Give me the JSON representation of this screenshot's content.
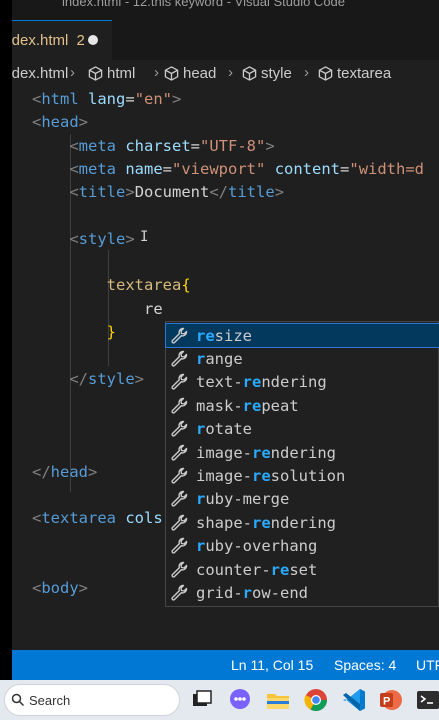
{
  "window": {
    "title": "index.html - 12.this keyword - Visual Studio Code"
  },
  "tab": {
    "label": "index.html",
    "problems": "2"
  },
  "breadcrumb": {
    "file": "index.html",
    "items": [
      "html",
      "head",
      "style",
      "textarea"
    ]
  },
  "code_lines": [
    [
      {
        "c": "t-brk",
        "t": "<"
      },
      {
        "c": "t-tag",
        "t": "html"
      },
      {
        "c": "t-txt",
        "t": " "
      },
      {
        "c": "t-attr",
        "t": "lang"
      },
      {
        "c": "t-txt",
        "t": "="
      },
      {
        "c": "t-str",
        "t": "\"en\""
      },
      {
        "c": "t-brk",
        "t": ">"
      }
    ],
    [
      {
        "c": "t-brk",
        "t": "<"
      },
      {
        "c": "t-tag",
        "t": "head"
      },
      {
        "c": "t-brk",
        "t": ">"
      }
    ],
    [
      {
        "c": "t-txt",
        "t": "    "
      },
      {
        "c": "t-brk",
        "t": "<"
      },
      {
        "c": "t-tag",
        "t": "meta"
      },
      {
        "c": "t-txt",
        "t": " "
      },
      {
        "c": "t-attr",
        "t": "charset"
      },
      {
        "c": "t-txt",
        "t": "="
      },
      {
        "c": "t-str",
        "t": "\"UTF-8\""
      },
      {
        "c": "t-brk",
        "t": ">"
      }
    ],
    [
      {
        "c": "t-txt",
        "t": "    "
      },
      {
        "c": "t-brk",
        "t": "<"
      },
      {
        "c": "t-tag",
        "t": "meta"
      },
      {
        "c": "t-txt",
        "t": " "
      },
      {
        "c": "t-attr",
        "t": "name"
      },
      {
        "c": "t-txt",
        "t": "="
      },
      {
        "c": "t-str",
        "t": "\"viewport\""
      },
      {
        "c": "t-txt",
        "t": " "
      },
      {
        "c": "t-attr",
        "t": "content"
      },
      {
        "c": "t-txt",
        "t": "="
      },
      {
        "c": "t-str",
        "t": "\"width=d"
      }
    ],
    [
      {
        "c": "t-txt",
        "t": "    "
      },
      {
        "c": "t-brk",
        "t": "<"
      },
      {
        "c": "t-tag",
        "t": "title"
      },
      {
        "c": "t-brk",
        "t": ">"
      },
      {
        "c": "t-txt",
        "t": "Document"
      },
      {
        "c": "t-brk",
        "t": "</"
      },
      {
        "c": "t-tag",
        "t": "title"
      },
      {
        "c": "t-brk",
        "t": ">"
      }
    ],
    [],
    [
      {
        "c": "t-txt",
        "t": "    "
      },
      {
        "c": "t-brk",
        "t": "<"
      },
      {
        "c": "t-tag",
        "t": "style"
      },
      {
        "c": "t-brk",
        "t": ">"
      }
    ],
    [],
    [
      {
        "c": "t-txt",
        "t": "        "
      },
      {
        "c": "t-sel",
        "t": "textarea"
      },
      {
        "c": "t-brace",
        "t": "{"
      }
    ],
    [
      {
        "c": "t-txt",
        "t": "            re"
      }
    ],
    [
      {
        "c": "t-txt",
        "t": "        "
      },
      {
        "c": "t-brace",
        "t": "}"
      }
    ],
    [],
    [
      {
        "c": "t-txt",
        "t": "    "
      },
      {
        "c": "t-brk",
        "t": "</"
      },
      {
        "c": "t-tag",
        "t": "style"
      },
      {
        "c": "t-brk",
        "t": ">"
      }
    ],
    [],
    [],
    [],
    [
      {
        "c": "t-brk",
        "t": "</"
      },
      {
        "c": "t-tag",
        "t": "head"
      },
      {
        "c": "t-brk",
        "t": ">"
      }
    ],
    [],
    [
      {
        "c": "t-brk",
        "t": "<"
      },
      {
        "c": "t-tag",
        "t": "textarea"
      },
      {
        "c": "t-txt",
        "t": " "
      },
      {
        "c": "t-attr",
        "t": "cols"
      }
    ],
    [],
    [],
    [
      {
        "c": "t-brk",
        "t": "<"
      },
      {
        "c": "t-tag",
        "t": "body"
      },
      {
        "c": "t-brk",
        "t": ">"
      }
    ]
  ],
  "suggestions": {
    "query": "re",
    "items": [
      {
        "label": "resize",
        "match": [
          0,
          2
        ]
      },
      {
        "label": "range",
        "match": [
          0,
          1
        ]
      },
      {
        "label": "text-rendering",
        "match": [
          5,
          7
        ]
      },
      {
        "label": "mask-repeat",
        "match": [
          5,
          7
        ]
      },
      {
        "label": "rotate",
        "match": [
          0,
          1
        ]
      },
      {
        "label": "image-rendering",
        "match": [
          6,
          8
        ]
      },
      {
        "label": "image-resolution",
        "match": [
          6,
          8
        ]
      },
      {
        "label": "ruby-merge",
        "match": [
          0,
          1
        ]
      },
      {
        "label": "shape-rendering",
        "match": [
          6,
          8
        ]
      },
      {
        "label": "ruby-overhang",
        "match": [
          0,
          1
        ]
      },
      {
        "label": "counter-reset",
        "match": [
          8,
          10
        ]
      },
      {
        "label": "grid-row-end",
        "match": [
          5,
          6
        ]
      }
    ],
    "selected_index": 0
  },
  "statusbar": {
    "position": "Ln 11, Col 15",
    "spaces": "Spaces: 4",
    "encoding": "UTF"
  },
  "taskbar": {
    "search_label": "Search",
    "apps": [
      "task-view-icon",
      "chat-icon",
      "file-explorer-icon",
      "chrome-icon",
      "vscode-icon",
      "powerpoint-icon",
      "terminal-icon"
    ]
  },
  "colors": {
    "accent": "#0078d4",
    "match": "#2aaaff",
    "editor_bg": "#1f1f1f"
  }
}
